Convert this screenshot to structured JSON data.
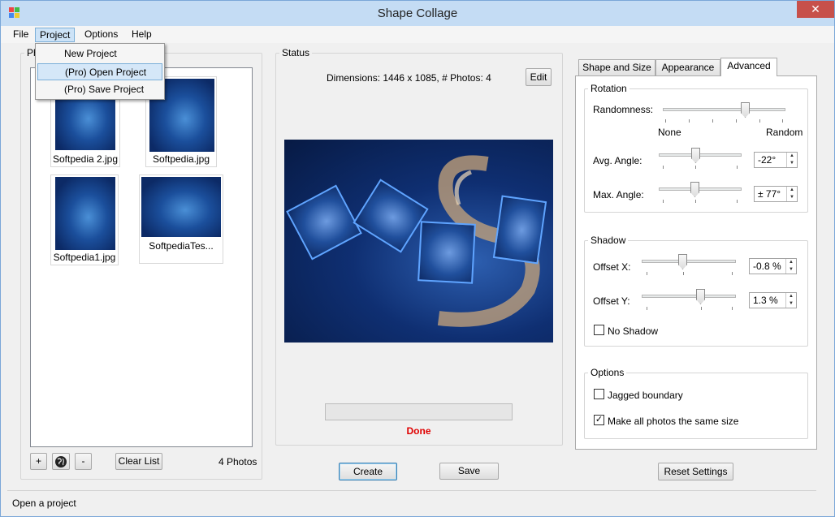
{
  "window": {
    "title": "Shape Collage",
    "close_symbol": "✕"
  },
  "menu": {
    "file": "File",
    "project": "Project",
    "options": "Options",
    "help": "Help"
  },
  "project_menu": {
    "items": [
      "New Project",
      "(Pro) Open Project",
      "(Pro) Save Project"
    ]
  },
  "photos": {
    "group_label": "Ph",
    "items": [
      {
        "caption": "Softpedia 2.jpg"
      },
      {
        "caption": "Softpedia.jpg"
      },
      {
        "caption": "Softpedia1.jpg"
      },
      {
        "caption": "SoftpediaTes..."
      }
    ],
    "add_label": "+",
    "remove_label": "-",
    "clear_label": "Clear List",
    "count_label": "4 Photos"
  },
  "status": {
    "group_label": "Status",
    "dimensions_text": "Dimensions: 1446 x 1085, # Photos: 4",
    "edit_label": "Edit",
    "done_text": "Done"
  },
  "actions": {
    "create_label": "Create",
    "save_label": "Save",
    "reset_label": "Reset Settings"
  },
  "tabs": [
    {
      "label": "Shape and Size"
    },
    {
      "label": "Appearance"
    },
    {
      "label": "Advanced",
      "active": true
    }
  ],
  "rotation": {
    "group_label": "Rotation",
    "randomness_label": "Randomness:",
    "none_label": "None",
    "random_label": "Random",
    "avg_angle_label": "Avg. Angle:",
    "avg_angle_value": "-22°",
    "max_angle_label": "Max. Angle:",
    "max_angle_value": "± 77°"
  },
  "shadow": {
    "group_label": "Shadow",
    "offset_x_label": "Offset X:",
    "offset_x_value": "-0.8 %",
    "offset_y_label": "Offset Y:",
    "offset_y_value": "1.3 %",
    "no_shadow_label": "No Shadow",
    "no_shadow_checked": false
  },
  "options": {
    "group_label": "Options",
    "jagged_label": "Jagged boundary",
    "jagged_checked": false,
    "same_size_label": "Make all photos the same size",
    "same_size_checked": true,
    "checkmark": "✓"
  },
  "statusbar": {
    "text": "Open a project"
  },
  "colors": {
    "done": "#e00000",
    "title_bar": "#c4dcf4",
    "close": "#c7504a",
    "tile_border": "#5fa4ff"
  }
}
